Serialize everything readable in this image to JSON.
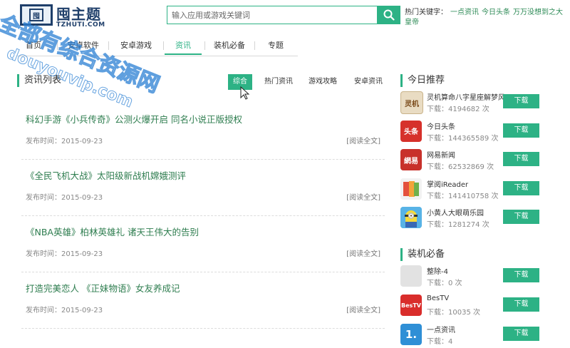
{
  "header": {
    "logo_text": "囤主题",
    "logo_sub": "TZHUTI.COM",
    "search_placeholder": "输入应用或游戏关键词",
    "hot_label": "热门关键字：",
    "hot_keywords": [
      "一点资讯",
      "今日头条",
      "万万没想到之大皇帝"
    ]
  },
  "nav": {
    "items": [
      "首页",
      "安卓软件",
      "安卓游戏",
      "资讯",
      "装机必备",
      "专题"
    ],
    "active": "资讯"
  },
  "list": {
    "title": "资讯列表",
    "filters": [
      "综合",
      "热门资讯",
      "游戏攻略",
      "安卓资讯"
    ],
    "active_filter": "综合",
    "date_prefix": "发布时间：",
    "more_label": "[阅读全文]",
    "articles": [
      {
        "title": "科幻手游《小兵传奇》公测火爆开启 同名小说正版授权",
        "date": "2015-09-23"
      },
      {
        "title": "《全民飞机大战》太阳级新战机嫦娥测评",
        "date": "2015-09-23"
      },
      {
        "title": "《NBA英雄》柏林英雄礼 诸天王伟大的告别",
        "date": "2015-09-23"
      },
      {
        "title": "打造完美恋人 《正妹物语》女友养成记",
        "date": "2015-09-23"
      }
    ]
  },
  "sidebar": {
    "today_title": "今日推荐",
    "today_apps": [
      {
        "name": "灵机算命八字星座解梦风",
        "downloads": "下载：4194682 次",
        "icon": "lingji-icon",
        "color": "#e9dcc3",
        "glyph": "灵机"
      },
      {
        "name": "今日头条",
        "downloads": "下载：144365589 次",
        "icon": "toutiao-icon",
        "color": "#d6312b",
        "glyph": "头条"
      },
      {
        "name": "网易新闻",
        "downloads": "下载：62532869 次",
        "icon": "netease-icon",
        "color": "#c8312b",
        "glyph": "網易"
      },
      {
        "name": "掌阅iReader",
        "downloads": "下载：141410758 次",
        "icon": "ireader-icon",
        "color": "#d64a3a",
        "glyph": ""
      },
      {
        "name": "小黄人大眼萌乐园",
        "downloads": "下载：1281274 次",
        "icon": "minion-icon",
        "color": "#58b3e6",
        "glyph": ""
      }
    ],
    "must_title": "装机必备",
    "must_apps": [
      {
        "name": "整除-4",
        "downloads": "下载：0 次",
        "icon": "placeholder-app-icon",
        "color": "#e2e2e2",
        "glyph": ""
      },
      {
        "name": "BesTV",
        "downloads": "下载：10035 次",
        "icon": "bestv-icon",
        "color": "#d92d2b",
        "glyph": "BesTV"
      },
      {
        "name": "一点资讯",
        "downloads": "下载：4",
        "icon": "yidian-icon",
        "color": "#2f8fd6",
        "glyph": "1."
      }
    ],
    "download_label": "下载"
  },
  "watermark": {
    "lines": [
      "全部有综合资源网",
      "douyouvip.com"
    ],
    "color": "#2a7fd4"
  }
}
